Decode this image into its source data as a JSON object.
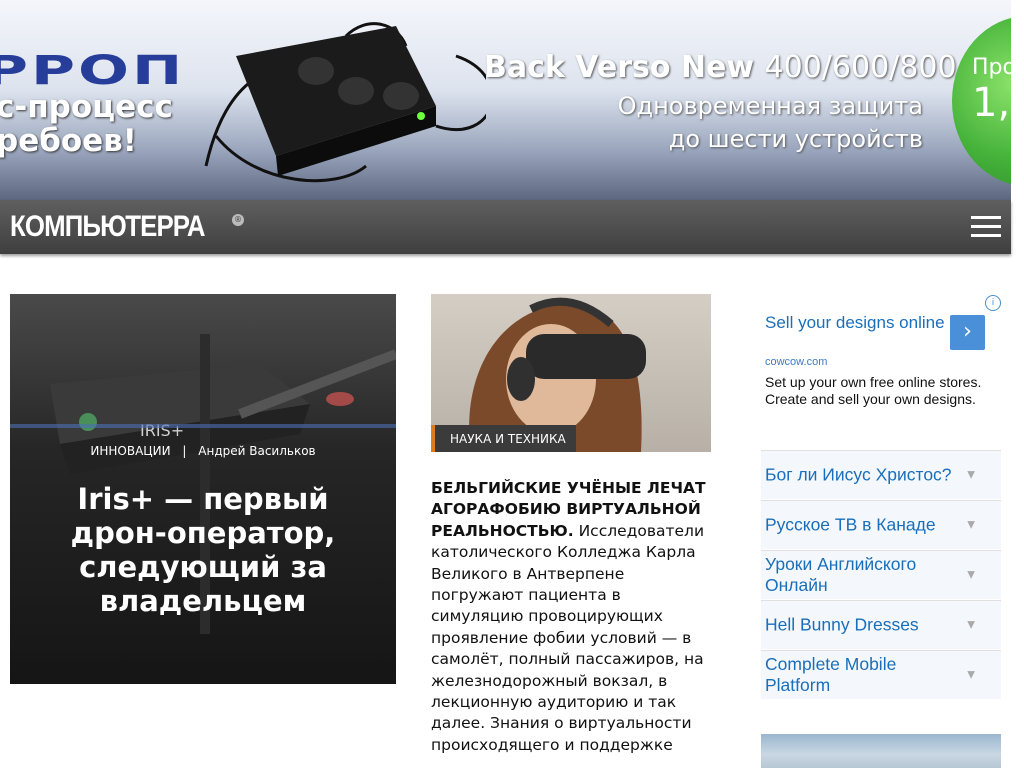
{
  "banner": {
    "brand": "РРОП",
    "left_text": [
      "с-процесс",
      "ребоев!"
    ],
    "title_bold": "Back Verso New",
    "title_light": "400/600/800",
    "subtitle": [
      "Одновременная защита",
      "до шести устройств"
    ],
    "green_text_top": "Про",
    "green_text_big": "1,"
  },
  "header": {
    "logo": "КОМПЬЮТЕРРА",
    "logo_mark": "®",
    "menu_icon": "hamburger-icon"
  },
  "feature": {
    "category": "ИННОВАЦИИ",
    "separator": "|",
    "author": "Андрей Васильков",
    "title": "Iris+ — первый дрон-оператор, следующий за владельцем"
  },
  "article": {
    "category": "НАУКА И ТЕХНИКА",
    "headline": "БЕЛЬГИЙСКИЕ УЧЁНЫЕ ЛЕЧАТ АГОРАФОБИЮ ВИРТУАЛЬНОЙ РЕАЛЬНОСТЬЮ.",
    "body": "Исследователи католического Колледжа Карла Великого в Антверпене погружают пациента в симуляцию провоцирующих проявление фобии условий — в самолёт, полный пассажиров, на железнодорожный вокзал, в лекционную аудиторию и так далее. Знания о виртуальности происходящего и поддержке"
  },
  "ad": {
    "headline": "Sell your designs online",
    "domain": "cowcow.com",
    "body": "Set up your own free online stores. Create and sell your own designs.",
    "info_icon": "i",
    "arrow": "›",
    "links": [
      "Бог ли Иисус Христос?",
      "Русское ТВ в Канаде",
      "Уроки Английского Онлайн",
      "Hell Bunny Dresses",
      "Complete Mobile Platform"
    ],
    "chevron": "▼"
  }
}
